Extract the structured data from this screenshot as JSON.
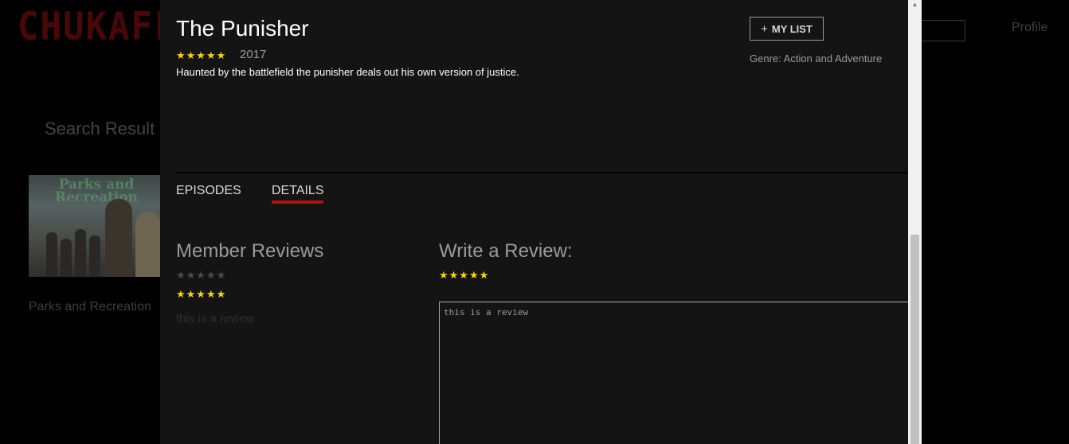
{
  "background": {
    "logo": "CHUKAFL",
    "profile": "Profile",
    "search_results_heading": "Search Result",
    "result_thumbnail_title": "Parks and Recreation",
    "result_title": "Parks and Recreation"
  },
  "modal": {
    "title": "The Punisher",
    "rating_stars": "★★★★★",
    "year": "2017",
    "synopsis": "Haunted by the battlefield the punisher deals out his own version of justice.",
    "my_list": {
      "icon": "+",
      "label": "MY LIST"
    },
    "genre_label": "Genre:",
    "genre_value": "Action and Adventure",
    "tabs": [
      {
        "label": "EPISODES",
        "active": false
      },
      {
        "label": "DETAILS",
        "active": true
      }
    ],
    "member_reviews": {
      "heading": "Member Reviews",
      "reviews": [
        {
          "stars": "★★★★★",
          "rating": 0
        },
        {
          "stars": "★★★★★",
          "rating": 5,
          "text": "this is a review"
        }
      ]
    },
    "write_review": {
      "heading": "Write a Review:",
      "stars": "★★★★★",
      "rating": 5,
      "textarea_value": "this is a review"
    }
  },
  "colors": {
    "accent_red": "#b90e0e",
    "star_yellow": "#f5d40a",
    "modal_bg": "#141414"
  }
}
